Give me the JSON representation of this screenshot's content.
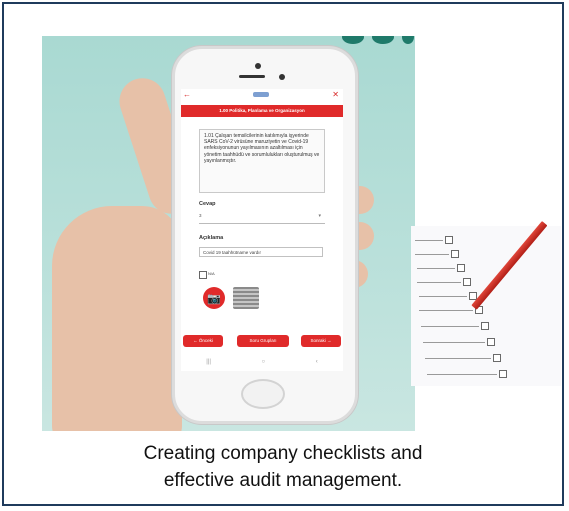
{
  "app": {
    "section_title": "1.00 Politika, Planlama ve Organizasyon",
    "question_text": "1.01 Çalışan temsilcilerinin katılımıyla işyerinde SARS CoV-2 virüsüne maruziyetin ve Covid-19 enfeksiyonunun yayılmasının azaltılması için yönetim taahhüdü ve sorumlulukları oluşturulmuş ve yayınlanmıştır.",
    "answer_label": "Cevap",
    "answer_value": "3",
    "description_label": "Açıklama",
    "description_value": "Covid 19 taahhütname vardır",
    "na_label": "N/A",
    "prev_button": "← Önceki",
    "groups_button": "Soru Grupları",
    "next_button": "Sonraki →"
  },
  "caption": {
    "line1": "Creating company checklists and",
    "line2": "effective audit management."
  },
  "colors": {
    "accent": "#e02a2a",
    "border": "#1f3b5c",
    "background": "#a9d9d2"
  }
}
